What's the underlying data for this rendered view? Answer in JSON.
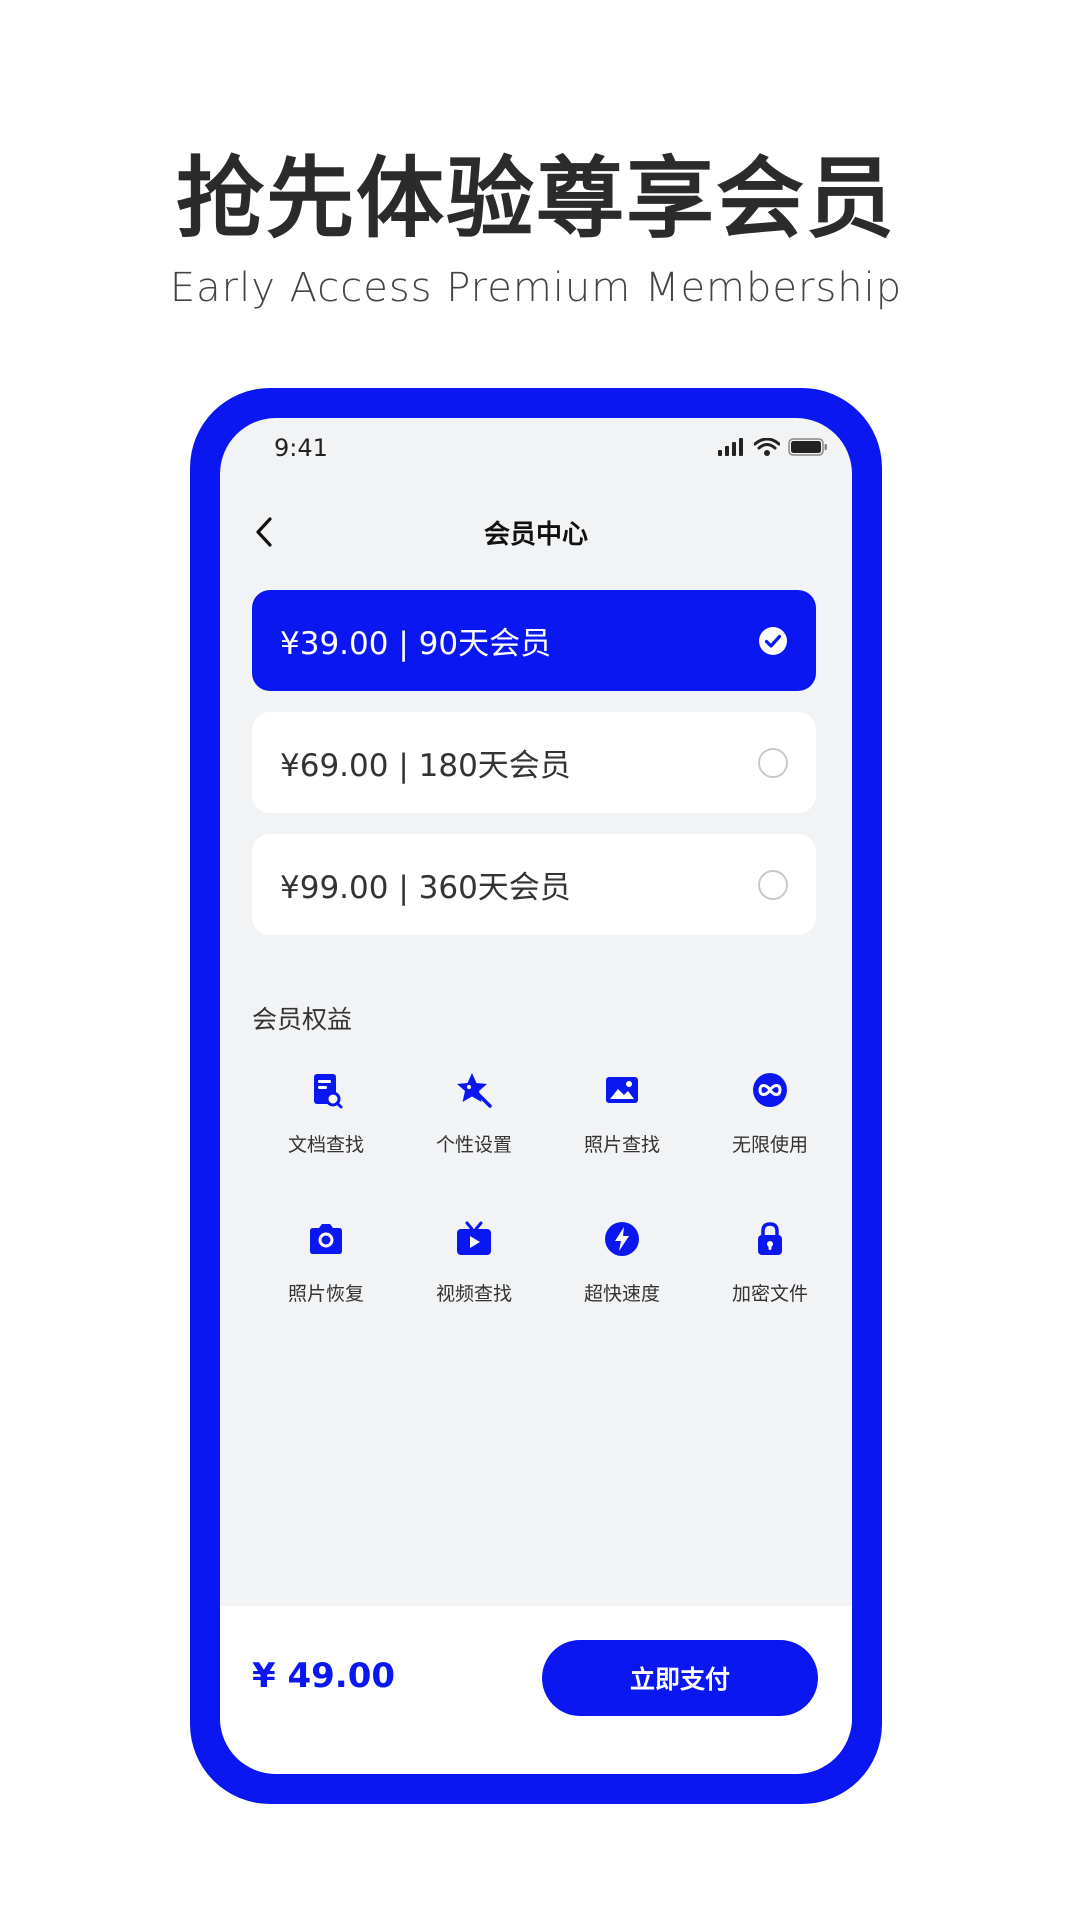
{
  "banner": {
    "title": "抢先体验尊享会员",
    "subtitle": "Early Access Premium Membership"
  },
  "status_bar": {
    "time": "9:41"
  },
  "nav": {
    "title": "会员中心"
  },
  "plans": [
    {
      "label": "¥39.00 | 90天会员",
      "selected": true
    },
    {
      "label": "¥69.00 | 180天会员",
      "selected": false
    },
    {
      "label": "¥99.00 | 360天会员",
      "selected": false
    }
  ],
  "benefits": {
    "title": "会员权益",
    "items": [
      {
        "label": "文档查找",
        "icon": "document-search-icon"
      },
      {
        "label": "个性设置",
        "icon": "star-edit-icon"
      },
      {
        "label": "照片查找",
        "icon": "image-icon"
      },
      {
        "label": "无限使用",
        "icon": "infinity-icon"
      },
      {
        "label": "照片恢复",
        "icon": "camera-icon"
      },
      {
        "label": "视频查找",
        "icon": "tv-play-icon"
      },
      {
        "label": "超快速度",
        "icon": "lightning-icon"
      },
      {
        "label": "加密文件",
        "icon": "lock-icon"
      }
    ]
  },
  "footer": {
    "total": "¥ 49.00",
    "pay_label": "立即支付"
  },
  "colors": {
    "accent": "#0a17f0",
    "screen_bg": "#f2f3f5"
  }
}
